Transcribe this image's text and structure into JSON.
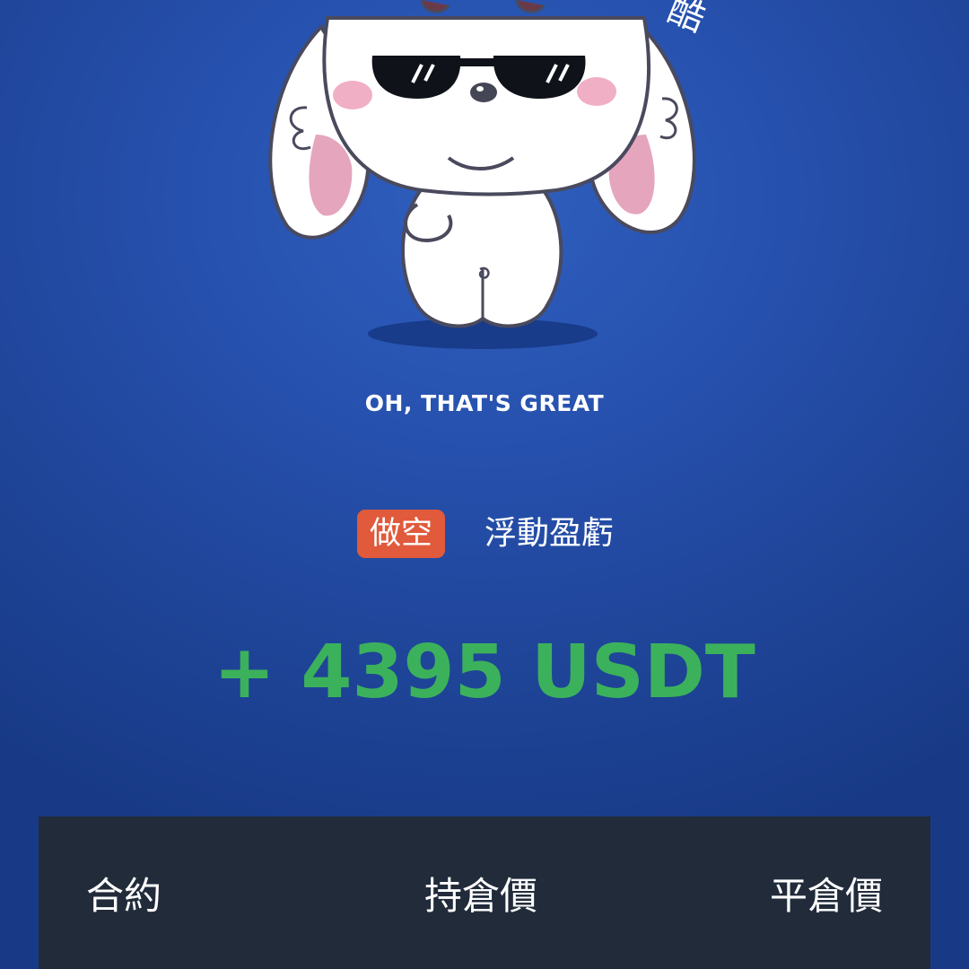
{
  "mascot": {
    "icon": "sunglasses-bunny-icon",
    "corner_glyph": "酷"
  },
  "tagline": "OH, THAT'S GREAT",
  "position": {
    "side": "做空",
    "side_color": "#e05a3b",
    "pnl_label": "浮動盈虧"
  },
  "pnl": {
    "amount": "+ 4395 USDT",
    "color": "#3cb15c"
  },
  "details": {
    "headers": {
      "contract": "合約",
      "entry_price": "持倉價",
      "close_price": "平倉價"
    }
  },
  "colors": {
    "background": "#2650ad",
    "panel": "#212b3a"
  }
}
